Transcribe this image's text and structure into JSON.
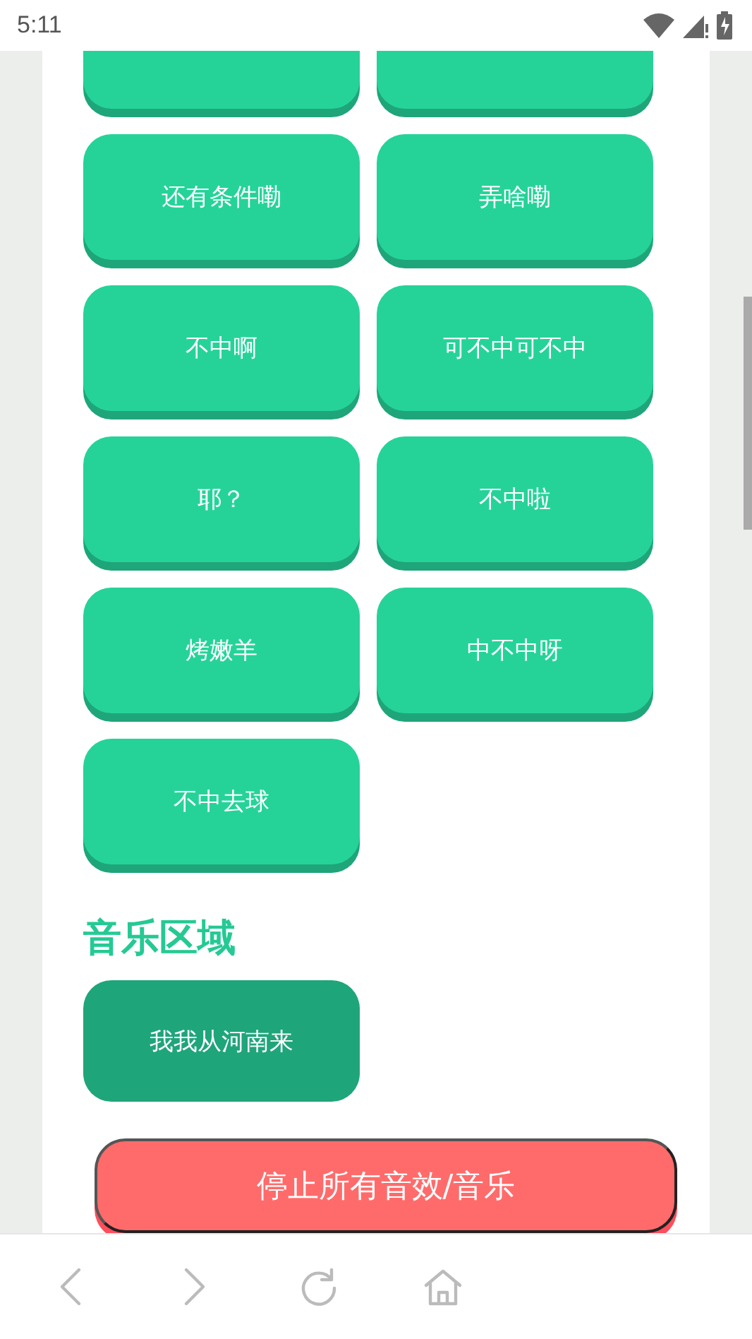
{
  "status_bar": {
    "time": "5:11"
  },
  "sound_buttons": [
    {
      "kind": "cut"
    },
    {
      "kind": "cut"
    },
    {
      "kind": "sound",
      "label": "还有条件嘞"
    },
    {
      "kind": "sound",
      "label": "弄啥嘞"
    },
    {
      "kind": "sound",
      "label": "不中啊"
    },
    {
      "kind": "sound",
      "label": "可不中可不中"
    },
    {
      "kind": "sound",
      "label": "耶？"
    },
    {
      "kind": "sound",
      "label": "不中啦"
    },
    {
      "kind": "sound",
      "label": "烤嫩羊"
    },
    {
      "kind": "sound",
      "label": "中不中呀"
    },
    {
      "kind": "sound",
      "label": "不中去球"
    }
  ],
  "music_section": {
    "title": "音乐区域",
    "buttons": [
      {
        "label": "我我从河南来"
      }
    ]
  },
  "stop_button": {
    "label": "停止所有音效/音乐"
  },
  "browser_nav": [
    {
      "kind": "back"
    },
    {
      "kind": "forward"
    },
    {
      "kind": "reload"
    },
    {
      "kind": "home"
    }
  ]
}
